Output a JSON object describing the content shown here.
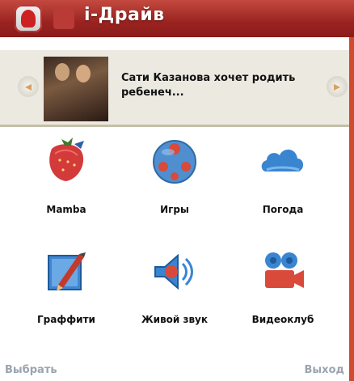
{
  "app": {
    "title": "i-Драйв",
    "logo_icon": "app-logo-icon"
  },
  "news": {
    "headline": "Сати Казанова хочет родить ребенеч...",
    "prev_icon": "arrow-left-icon",
    "next_icon": "arrow-right-icon"
  },
  "apps": [
    {
      "label": "Mamba",
      "icon": "strawberry-icon"
    },
    {
      "label": "Игры",
      "icon": "ball-icon"
    },
    {
      "label": "Погода",
      "icon": "cloud-icon"
    },
    {
      "label": "Граффити",
      "icon": "pencil-icon"
    },
    {
      "label": "Живой звук",
      "icon": "speaker-icon"
    },
    {
      "label": "Видеоклуб",
      "icon": "video-camera-icon"
    }
  ],
  "softkeys": {
    "left": "Выбрать",
    "right": "Выход"
  },
  "colors": {
    "titlebar": "#9a2320",
    "accent": "#d24a2e",
    "news_background": "#ece9e1",
    "softkey_text": "#9aa4b0"
  }
}
